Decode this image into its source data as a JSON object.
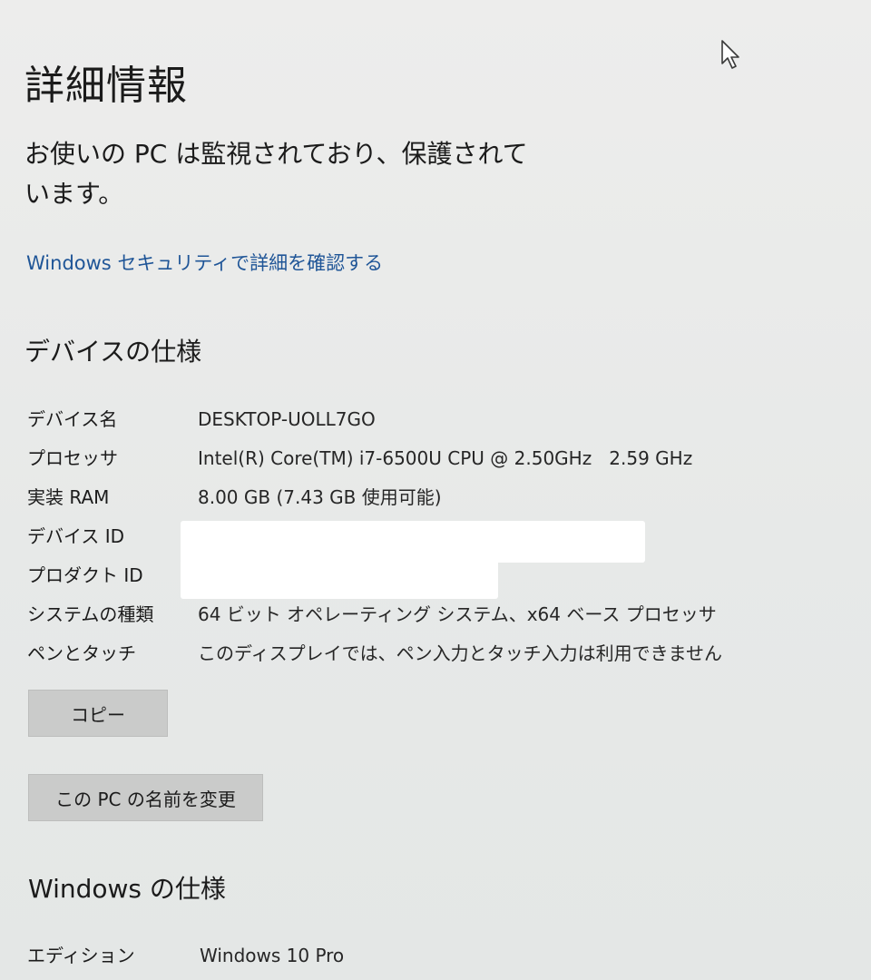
{
  "page_title": "詳細情報",
  "protection_message": "お使いの PC は監視されており、保護されています。",
  "security_link": "Windows セキュリティで詳細を確認する",
  "device_specs": {
    "heading": "デバイスの仕様",
    "rows": [
      {
        "label": "デバイス名",
        "value": "DESKTOP-UOLL7GO"
      },
      {
        "label": "プロセッサ",
        "value": "Intel(R) Core(TM) i7-6500U CPU @ 2.50GHz   2.59 GHz"
      },
      {
        "label": "実装 RAM",
        "value": "8.00 GB (7.43 GB 使用可能)"
      },
      {
        "label": "デバイス ID",
        "value": ""
      },
      {
        "label": "プロダクト ID",
        "value": ""
      },
      {
        "label": "システムの種類",
        "value": "64 ビット オペレーティング システム、x64 ベース プロセッサ"
      },
      {
        "label": "ペンとタッチ",
        "value": "このディスプレイでは、ペン入力とタッチ入力は利用できません"
      }
    ],
    "copy_button": "コピー",
    "rename_button": "この PC の名前を変更"
  },
  "windows_specs": {
    "heading": "Windows の仕様",
    "rows": [
      {
        "label": "エディション",
        "value": "Windows 10 Pro"
      }
    ]
  },
  "icons": {
    "cursor": "mouse-pointer-icon"
  }
}
